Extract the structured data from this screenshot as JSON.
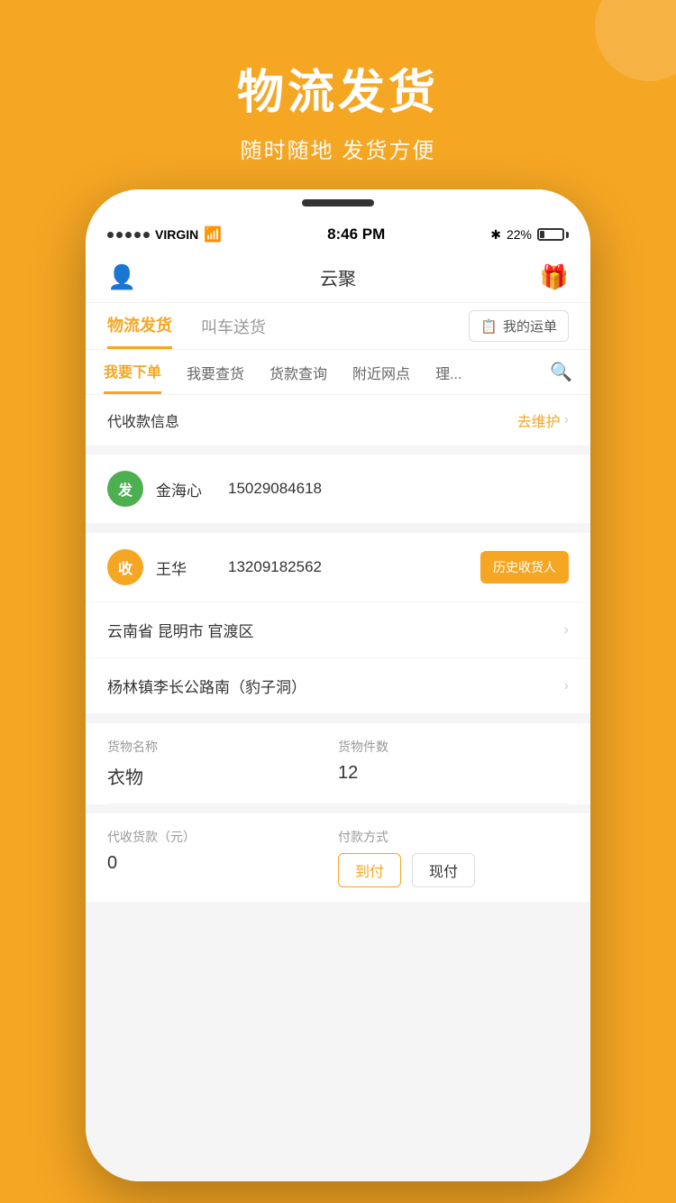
{
  "background": {
    "color": "#F5A623"
  },
  "header": {
    "title": "物流发货",
    "subtitle": "随时随地 发货方便"
  },
  "status_bar": {
    "carrier": "VIRGIN",
    "time": "8:46 PM",
    "battery_percent": "22%",
    "bluetooth": "✱"
  },
  "app_bar": {
    "title": "云聚",
    "user_icon": "👤",
    "gift_icon": "🎁"
  },
  "tabs": [
    {
      "label": "物流发货",
      "active": true
    },
    {
      "label": "叫车送货",
      "active": false
    }
  ],
  "waybill_btn": "我的运单",
  "sub_nav": [
    {
      "label": "我要下单",
      "active": true
    },
    {
      "label": "我要查货",
      "active": false
    },
    {
      "label": "货款查询",
      "active": false
    },
    {
      "label": "附近网点",
      "active": false
    },
    {
      "label": "理...",
      "active": false
    }
  ],
  "collect_info": {
    "label": "代收款信息",
    "action": "去维护"
  },
  "sender": {
    "avatar_text": "发",
    "name": "金海心",
    "phone": "15029084618"
  },
  "receiver": {
    "avatar_text": "收",
    "name": "王华",
    "phone": "13209182562",
    "history_btn": "历史收货人"
  },
  "address1": {
    "text": "云南省 昆明市 官渡区"
  },
  "address2": {
    "text": "杨林镇李长公路南（豹子洞）"
  },
  "goods": {
    "name_label": "货物名称",
    "name_value": "衣物",
    "count_label": "货物件数",
    "count_value": "12"
  },
  "payment": {
    "cod_label": "代收货款（元）",
    "cod_value": "0",
    "method_label": "付款方式",
    "options": [
      {
        "label": "到付",
        "selected": true
      },
      {
        "label": "现付",
        "selected": false
      }
    ]
  }
}
